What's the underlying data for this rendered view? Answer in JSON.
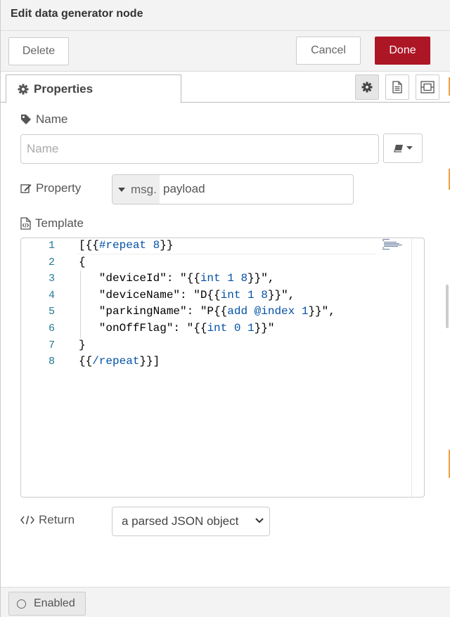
{
  "title": "Edit data generator node",
  "toolbar": {
    "delete_label": "Delete",
    "cancel_label": "Cancel",
    "done_label": "Done"
  },
  "tabs": {
    "properties_label": "Properties",
    "icons": [
      "gear-icon",
      "description-icon",
      "appearance-icon"
    ]
  },
  "name_row": {
    "label": "Name",
    "placeholder": "Name",
    "value": ""
  },
  "property_row": {
    "label": "Property",
    "type_label": "msg.",
    "value": "payload"
  },
  "template_row": {
    "label": "Template",
    "line_numbers": [
      "1",
      "2",
      "3",
      "4",
      "5",
      "6",
      "7",
      "8"
    ],
    "lines": [
      "[{{#repeat 8}}",
      "{",
      "   \"deviceId\": \"{{int 1 8}}\",",
      "   \"deviceName\": \"D{{int 1 8}}\",",
      "   \"parkingName\": \"P{{add @index 1}}\",",
      "   \"onOffFlag\": \"{{int 0 1}}\"",
      "}",
      "{{/repeat}}]"
    ]
  },
  "return_row": {
    "label": "Return",
    "selected": "a parsed JSON object"
  },
  "footer": {
    "enabled_label": "Enabled"
  },
  "colors": {
    "done_bg": "#ad1625",
    "accent_orange": "#f0a040"
  }
}
